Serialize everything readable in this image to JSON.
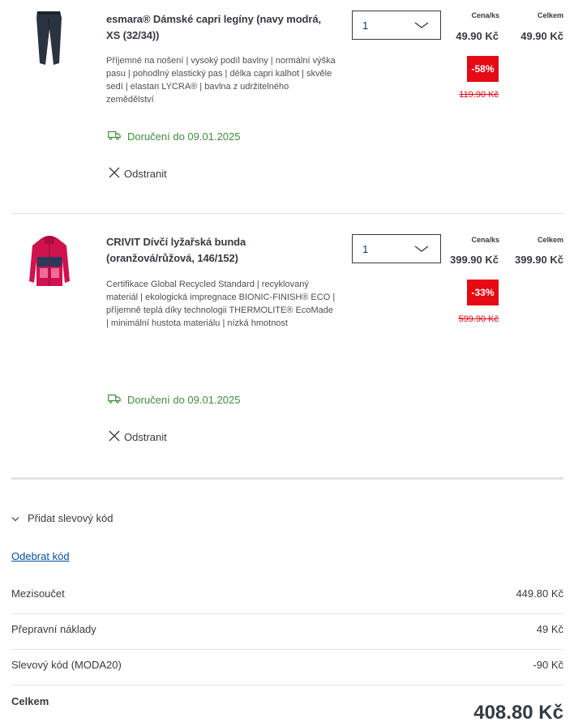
{
  "items": [
    {
      "name": "esmara® Dámské capri legíny (navy modrá, XS (32/34))",
      "description": "Příjemné na nošení | vysoký podíl bavlny | normální výška pasu | pohodlný elastický pas | délka capri kalhot | skvěle sedí | elastan LYCRA® | bavlna z udržitelného zemědělství",
      "quantity": "1",
      "unit_price_label": "Cena/ks",
      "unit_price": "49.90 Kč",
      "total_label": "Celkem",
      "total": "49.90 Kč",
      "discount": "-58%",
      "old_price": "119.90 Kč",
      "delivery": "Doručení do 09.01.2025",
      "remove_label": "Odstranit",
      "image_icon": "leggings-icon",
      "image_color": "#2b3340"
    },
    {
      "name": "CRIVIT Dívčí lyžařská bunda (oranžová/růžová, 146/152)",
      "description": "Certifikace Global Recycled Standard | recyklovaný materiál | ekologická impregnace BIONIC-FINISH® ECO | příjemně teplá díky technologii THERMOLITE® EcoMade | minimální hustota materiálu | nízká hmotnost",
      "quantity": "1",
      "unit_price_label": "Cena/ks",
      "unit_price": "399.90 Kč",
      "total_label": "Celkem",
      "total": "399.90 Kč",
      "discount": "-33%",
      "old_price": "599.90 Kč",
      "delivery": "Doručení do 09.01.2025",
      "remove_label": "Odstranit",
      "image_icon": "ski-jacket-icon",
      "image_color": "#d0124f"
    }
  ],
  "summary": {
    "promo_toggle": "Přidat slevový kód",
    "remove_code": "Odebrat kód",
    "subtotal_label": "Mezisoučet",
    "subtotal": "449.80 Kč",
    "shipping_label": "Přepravní náklady",
    "shipping": "49 Kč",
    "discount_label": "Slevový kód (MODA20)",
    "discount": "-90 Kč",
    "total_label": "Celkem",
    "total": "408.80 Kč"
  },
  "colors": {
    "discount_red": "#e60a14",
    "delivery_green": "#3f8e3a",
    "link_blue": "#0050aa",
    "text_dark": "#353b42"
  }
}
